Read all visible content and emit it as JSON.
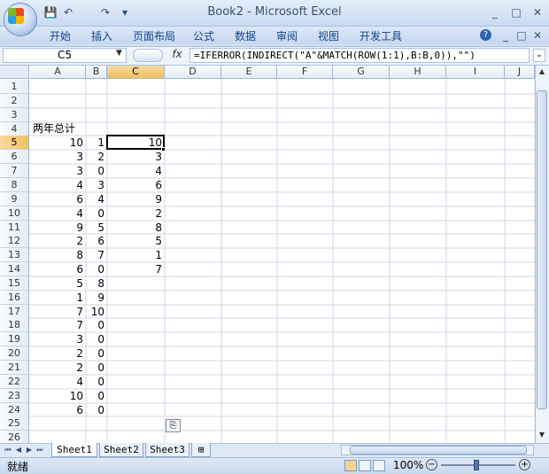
{
  "window": {
    "title": "Book2 - Microsoft Excel",
    "controls": {
      "minimize": "_",
      "restore": "□",
      "close": "✕"
    }
  },
  "qat": {
    "save": "💾",
    "undo": "↶",
    "redo": "↷",
    "more": "▾"
  },
  "ribbon": {
    "tabs": [
      "开始",
      "插入",
      "页面布局",
      "公式",
      "数据",
      "审阅",
      "视图",
      "开发工具"
    ],
    "help": "?",
    "wnd": {
      "min": "_",
      "restore": "□",
      "close": "✕"
    }
  },
  "formula_bar": {
    "name_box": "C5",
    "fx": "fx",
    "formula": "=IFERROR(INDIRECT(\"A\"&MATCH(ROW(1:1),B:B,0)),\"\")"
  },
  "sheet": {
    "columns": [
      "A",
      "B",
      "C",
      "D",
      "E",
      "F",
      "G",
      "H",
      "I",
      "J"
    ],
    "selected_column": "C",
    "selected_row": 5,
    "row_numbers": [
      "1",
      "2",
      "3",
      "4",
      "5",
      "6",
      "7",
      "8",
      "9",
      "10",
      "11",
      "12",
      "13",
      "14",
      "15",
      "16",
      "17",
      "18",
      "19",
      "20",
      "21",
      "22",
      "23",
      "24",
      "25",
      "26"
    ],
    "header_label": "两年总计",
    "col_A": [
      "10",
      "3",
      "3",
      "4",
      "6",
      "4",
      "9",
      "2",
      "8",
      "6",
      "5",
      "1",
      "7",
      "7",
      "3",
      "2",
      "2",
      "4",
      "10",
      "6"
    ],
    "col_B": [
      "1",
      "2",
      "0",
      "3",
      "4",
      "0",
      "5",
      "6",
      "7",
      "0",
      "8",
      "9",
      "10",
      "0",
      "0",
      "0",
      "0",
      "0",
      "0",
      "0"
    ],
    "col_C": [
      "10",
      "3",
      "4",
      "6",
      "9",
      "2",
      "8",
      "5",
      "1",
      "7"
    ]
  },
  "sheet_tabs": [
    "Sheet1",
    "Sheet2",
    "Sheet3"
  ],
  "active_sheet": "Sheet1",
  "status": {
    "ready": "就绪",
    "zoom": "100%"
  },
  "colors": {
    "accent": "#15428b",
    "selection_header": "#f1c15f",
    "gridline": "#d0d7e5"
  }
}
